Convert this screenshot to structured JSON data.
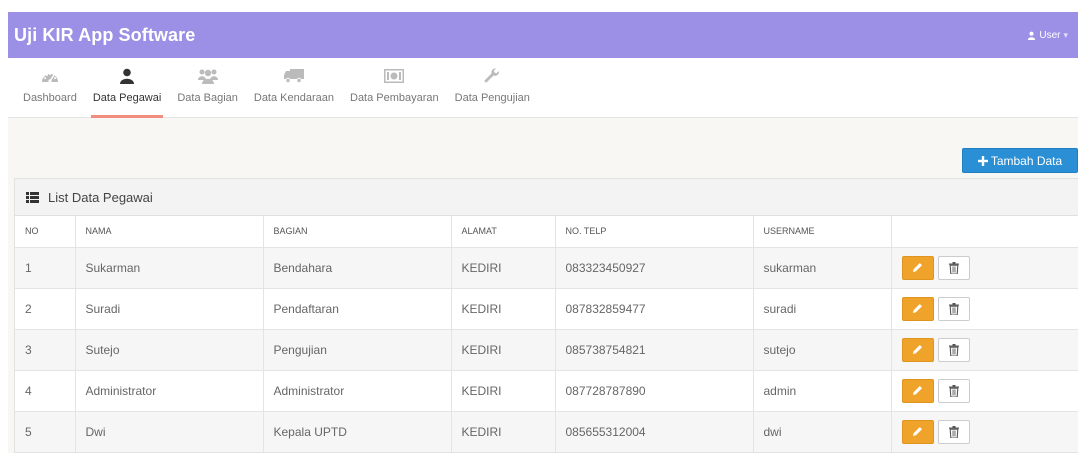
{
  "app": {
    "title": "Uji KIR App Software",
    "user_label": "User",
    "user_caret": "▾"
  },
  "nav": {
    "items": [
      {
        "label": "Dashboard",
        "icon": "dashboard-icon",
        "active": false
      },
      {
        "label": "Data Pegawai",
        "icon": "user-icon",
        "active": true
      },
      {
        "label": "Data Bagian",
        "icon": "group-icon",
        "active": false
      },
      {
        "label": "Data Kendaraan",
        "icon": "truck-icon",
        "active": false
      },
      {
        "label": "Data Pembayaran",
        "icon": "money-icon",
        "active": false
      },
      {
        "label": "Data Pengujian",
        "icon": "wrench-icon",
        "active": false
      }
    ]
  },
  "actions": {
    "add_label": "Tambah Data",
    "add_icon": "plus-icon"
  },
  "panel": {
    "title": "List Data Pegawai",
    "icon": "list-icon"
  },
  "table": {
    "headers": [
      "NO",
      "NAMA",
      "BAGIAN",
      "ALAMAT",
      "NO. TELP",
      "USERNAME",
      ""
    ],
    "rows": [
      [
        "1",
        "Sukarman",
        "Bendahara",
        "KEDIRI",
        "083323450927",
        "sukarman"
      ],
      [
        "2",
        "Suradi",
        "Pendaftaran",
        "KEDIRI",
        "087832859477",
        "suradi"
      ],
      [
        "3",
        "Sutejo",
        "Pengujian",
        "KEDIRI",
        "085738754821",
        "sutejo"
      ],
      [
        "4",
        "Administrator",
        "Administrator",
        "KEDIRI",
        "087728787890",
        "admin"
      ],
      [
        "5",
        "Dwi",
        "Kepala UPTD",
        "KEDIRI",
        "085655312004",
        "dwi"
      ]
    ],
    "row_actions": {
      "edit_icon": "pencil-icon",
      "delete_icon": "trash-icon"
    }
  },
  "colors": {
    "header": "#9b8fe6",
    "primary": "#2a8fd4",
    "warning": "#f0a32a",
    "active_tab": "#f08d7e"
  }
}
